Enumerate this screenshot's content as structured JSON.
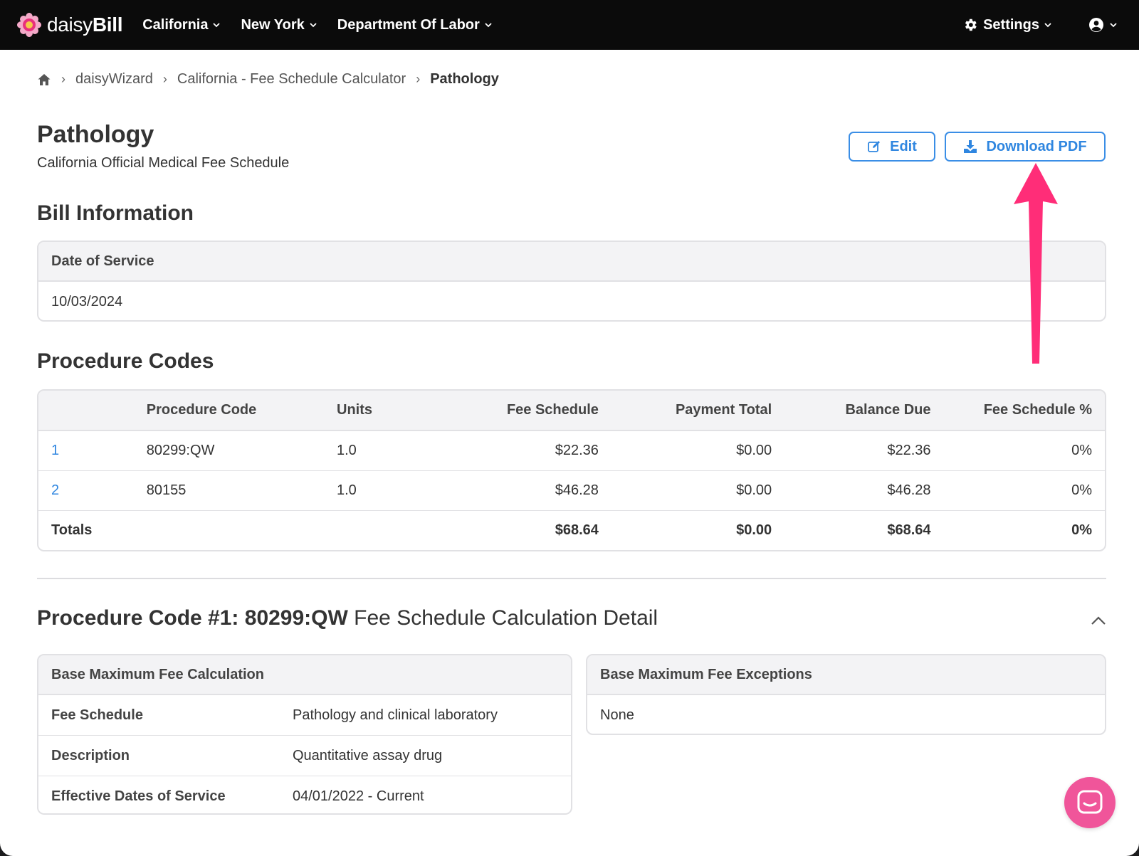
{
  "nav": {
    "logo_light": "daisy",
    "logo_bold": "Bill",
    "items": [
      {
        "label": "California"
      },
      {
        "label": "New York"
      },
      {
        "label": "Department Of Labor"
      }
    ],
    "settings_label": "Settings"
  },
  "breadcrumb": {
    "items": [
      "daisyWizard",
      "California - Fee Schedule Calculator"
    ],
    "current": "Pathology"
  },
  "header": {
    "title": "Pathology",
    "subtitle": "California Official Medical Fee Schedule",
    "edit_label": "Edit",
    "download_label": "Download PDF"
  },
  "bill_info": {
    "title": "Bill Information",
    "date_label": "Date of Service",
    "date_value": "10/03/2024"
  },
  "procedures": {
    "title": "Procedure Codes",
    "columns": [
      "",
      "Procedure Code",
      "Units",
      "Fee Schedule",
      "Payment Total",
      "Balance Due",
      "Fee Schedule %"
    ],
    "rows": [
      {
        "num": "1",
        "code": "80299:QW",
        "units": "1.0",
        "fee": "$22.36",
        "payment": "$0.00",
        "balance": "$22.36",
        "pct": "0%"
      },
      {
        "num": "2",
        "code": "80155",
        "units": "1.0",
        "fee": "$46.28",
        "payment": "$0.00",
        "balance": "$46.28",
        "pct": "0%"
      }
    ],
    "totals": {
      "label": "Totals",
      "fee": "$68.64",
      "payment": "$0.00",
      "balance": "$68.64",
      "pct": "0%"
    }
  },
  "detail": {
    "title_bold": "Procedure Code #1: 80299:QW",
    "title_rest": " Fee Schedule Calculation Detail",
    "calc": {
      "title": "Base Maximum Fee Calculation",
      "rows": [
        {
          "key": "Fee Schedule",
          "value": "Pathology and clinical laboratory"
        },
        {
          "key": "Description",
          "value": "Quantitative assay drug"
        },
        {
          "key": "Effective Dates of Service",
          "value": "04/01/2022 - Current"
        }
      ]
    },
    "exceptions": {
      "title": "Base Maximum Fee Exceptions",
      "value": "None"
    }
  },
  "colors": {
    "accent": "#2f86e0",
    "annotation_arrow": "#ff2d78",
    "chat": "#f0559a",
    "nav_bg": "#0b0b0b"
  }
}
